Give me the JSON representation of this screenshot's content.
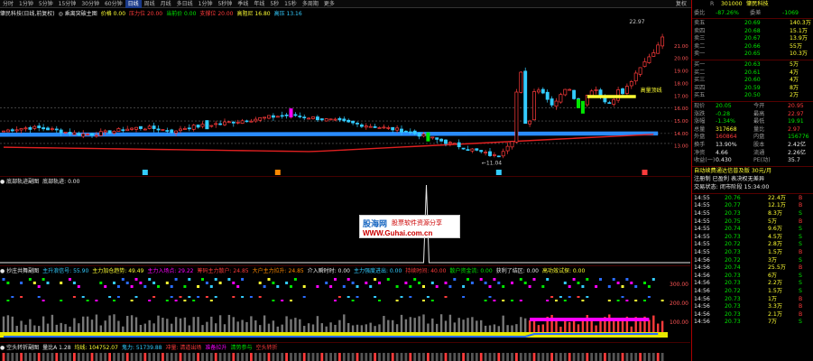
{
  "toolbar": {
    "items": [
      "分时",
      "1分钟",
      "5分钟",
      "15分钟",
      "30分钟",
      "60分钟",
      "日线",
      "周线",
      "月线",
      "多日线",
      "1分钟",
      "5秒钟",
      "季线",
      "年线",
      "5秒",
      "15秒",
      "多周期",
      "更多"
    ],
    "active_index": 6,
    "right_items": [
      "复权",
      "叠加",
      "分析",
      "统计",
      "F10",
      "标记",
      "返回"
    ]
  },
  "main_info": {
    "title": "肇民科技(日线,前复权)",
    "indicator": "◎ 乘离突破主图",
    "values": [
      {
        "text": "价格 0.00",
        "color": "#ffff33"
      },
      {
        "text": "压力位 20.00",
        "color": "#ff3b3b"
      },
      {
        "text": "当前价 0.00",
        "color": "#00e600"
      },
      {
        "text": "支撑位 20.00",
        "color": "#ff3b3b"
      },
      {
        "text": "高阻尼 16.80",
        "color": "#ffff33"
      },
      {
        "text": "高压  13.16",
        "color": "#3cf"
      }
    ]
  },
  "main_chart": {
    "price_labels": [
      "22.97",
      "21.00",
      "20.00",
      "19.00",
      "18.00",
      "17.00",
      "16.00",
      "15.00",
      "14.00",
      "13.00"
    ],
    "hi_label": "22.97",
    "lo_label": "11.04",
    "trend_note": "高量顶线",
    "markers": [
      "N",
      "S",
      "S",
      "S"
    ]
  },
  "panel2": {
    "title": "● 底部轨迹副图",
    "label": "底部轨迹: 0.00",
    "watermark": {
      "logo": "股海网",
      "slogan": "股票软件资源分享",
      "url": "WWW.Guhai.com.cn"
    }
  },
  "panel3": {
    "title": "● 抄庄共舞副图",
    "values": [
      {
        "text": "主升浪信号: 55.90",
        "color": "#3cf"
      },
      {
        "text": "主力加仓趋势: 49.49",
        "color": "#ffff33"
      },
      {
        "text": "主力入场点: 29.22",
        "color": "#f0f"
      },
      {
        "text": "筹码主力散户: 24.85",
        "color": "#ff3b3b"
      },
      {
        "text": "大户主力拉升: 24.85",
        "color": "#ff8800"
      },
      {
        "text": "介入瞬时时: 0.00",
        "color": "#e8e8e8"
      },
      {
        "text": "主力强度进出: 0.00",
        "color": "#3cf"
      },
      {
        "text": "持续时间: 40.00",
        "color": "#ff3b3b"
      },
      {
        "text": "散户资金流: 0.00",
        "color": "#00e600"
      },
      {
        "text": "获利了结区: 0.00",
        "color": "#e8e8e8"
      },
      {
        "text": "高功效试探: 0.00",
        "color": "#ffff33"
      }
    ],
    "axis": [
      "300.00",
      "200.00",
      "100.00"
    ]
  },
  "panel4": {
    "title": "● 空头转折副图",
    "values": [
      {
        "text": "量比A 1.28",
        "color": "#e8e8e8"
      },
      {
        "text": "均线: 104752.07",
        "color": "#ffff33"
      },
      {
        "text": "鬼力: 51739.88",
        "color": "#3cf"
      },
      {
        "text": "冲量: 清道出场",
        "color": "#ff3b3b"
      },
      {
        "text": "准备拉升",
        "color": "#f0f"
      },
      {
        "text": "清势参与",
        "color": "#00e600"
      },
      {
        "text": "空头转折",
        "color": "#ff3b3b"
      }
    ]
  },
  "quote": {
    "code": "301000",
    "name": "肇民科技",
    "weibi_label": "委比",
    "weibi": "-87.26%",
    "weicha_label": "委差",
    "weicha": "-1069",
    "asks": [
      {
        "label": "卖五",
        "price": "20.69",
        "vol": "140.3万"
      },
      {
        "label": "卖四",
        "price": "20.68",
        "vol": "15.1万"
      },
      {
        "label": "卖三",
        "price": "20.67",
        "vol": "13.9万"
      },
      {
        "label": "卖二",
        "price": "20.66",
        "vol": "55万"
      },
      {
        "label": "卖一",
        "price": "20.65",
        "vol": "10.3万"
      }
    ],
    "bids": [
      {
        "label": "买一",
        "price": "20.63",
        "vol": "5万"
      },
      {
        "label": "买二",
        "price": "20.61",
        "vol": "4万"
      },
      {
        "label": "买三",
        "price": "20.60",
        "vol": "4万"
      },
      {
        "label": "买四",
        "price": "20.59",
        "vol": "8万"
      },
      {
        "label": "买五",
        "price": "20.50",
        "vol": "2万"
      }
    ],
    "stats_left": [
      {
        "label": "现价",
        "value": "20.05"
      },
      {
        "label": "涨跌",
        "value": "-0.28"
      },
      {
        "label": "涨幅",
        "value": "-1.34%"
      },
      {
        "label": "总量",
        "value": "317668"
      },
      {
        "label": "外盘",
        "value": "160864"
      },
      {
        "label": "换手",
        "value": "13.90%"
      },
      {
        "label": "净资",
        "value": "4.66"
      },
      {
        "label": "收益(一)",
        "value": "0.430"
      }
    ],
    "stats_right": [
      {
        "label": "今开",
        "value": "20.95"
      },
      {
        "label": "最高",
        "value": "22.97"
      },
      {
        "label": "最低",
        "value": "19.91"
      },
      {
        "label": "量比",
        "value": "2.97"
      },
      {
        "label": "内盘",
        "value": "156776"
      },
      {
        "label": "股本",
        "value": "2.42亿"
      },
      {
        "label": "流通",
        "value": "2.26亿"
      },
      {
        "label": "PE(动)",
        "value": "35.7"
      }
    ],
    "notes": [
      "自动续费通达信普及版  30元/月",
      "注册制 已盈利 表决权无差异",
      "交易状态: 闭市阶段  15:34:00"
    ],
    "ticks": [
      {
        "time": "14:55",
        "price": "20.76",
        "vol": "22.4万",
        "side": "B"
      },
      {
        "time": "14:55",
        "price": "20.77",
        "vol": "12.1万",
        "side": "B"
      },
      {
        "time": "14:55",
        "price": "20.73",
        "vol": "8.3万",
        "side": "S"
      },
      {
        "time": "14:55",
        "price": "20.75",
        "vol": "5万",
        "side": "B"
      },
      {
        "time": "14:55",
        "price": "20.74",
        "vol": "9.6万",
        "side": "S"
      },
      {
        "time": "14:55",
        "price": "20.73",
        "vol": "4.5万",
        "side": "S"
      },
      {
        "time": "14:55",
        "price": "20.72",
        "vol": "2.8万",
        "side": "S"
      },
      {
        "time": "14:55",
        "price": "20.73",
        "vol": "1.5万",
        "side": "B"
      },
      {
        "time": "14:56",
        "price": "20.72",
        "vol": "3万",
        "side": "S"
      },
      {
        "time": "14:56",
        "price": "20.74",
        "vol": "25.5万",
        "side": "B"
      },
      {
        "time": "14:56",
        "price": "20.73",
        "vol": "6万",
        "side": "S"
      },
      {
        "time": "14:56",
        "price": "20.73",
        "vol": "2.2万",
        "side": "S"
      },
      {
        "time": "14:56",
        "price": "20.72",
        "vol": "1.5万",
        "side": "S"
      },
      {
        "time": "14:56",
        "price": "20.73",
        "vol": "1万",
        "side": "B"
      },
      {
        "time": "14:56",
        "price": "20.73",
        "vol": "3.3万",
        "side": "B"
      },
      {
        "time": "14:56",
        "price": "20.73",
        "vol": "2.1万",
        "side": "B"
      },
      {
        "time": "14:56",
        "price": "20.73",
        "vol": "7万",
        "side": "S"
      }
    ]
  }
}
